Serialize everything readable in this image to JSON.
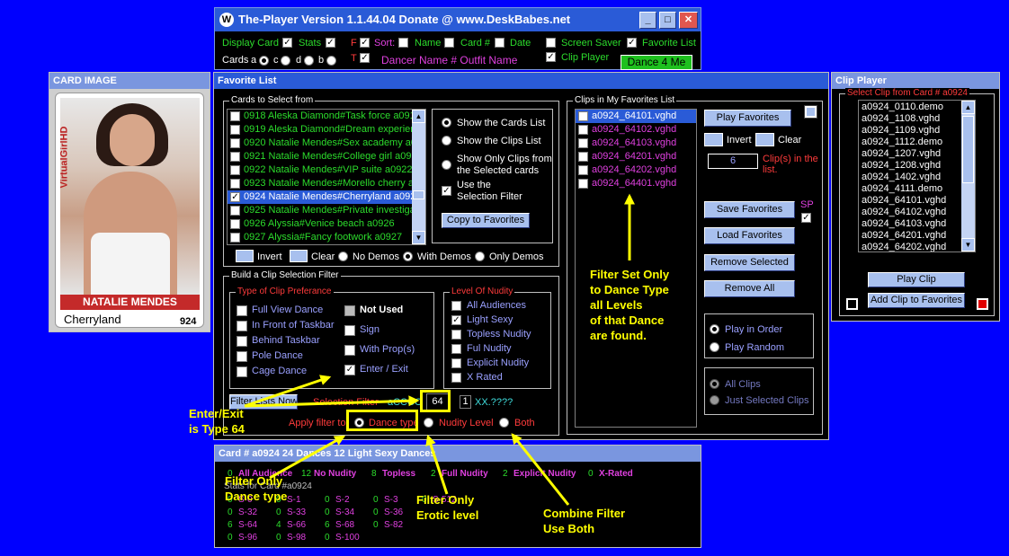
{
  "main_window": {
    "title": "The-Player  Version 1.1.44.04 Donate @ www.DeskBabes.net",
    "display_card": "Display Card",
    "stats": "Stats",
    "sort": "Sort:",
    "name": "Name",
    "card_num": "Card #",
    "date": "Date",
    "screen_saver": "Screen Saver",
    "favorite_list": "Favorite List",
    "cards": "Cards",
    "card_a": "a",
    "card_c": "c",
    "card_d": "d",
    "card_b": "b",
    "f": "F",
    "t": "T",
    "dancer_line": "Dancer Name # Outfit Name",
    "clip_player": "Clip Player",
    "dance_btn": "Dance 4 Me"
  },
  "card_image": {
    "title": "CARD IMAGE",
    "brand": "VirtualGirlHD",
    "name_banner": "NATALIE MENDES",
    "outfit": "Cherryland",
    "number": "924"
  },
  "favorite": {
    "title": "Favorite List",
    "cards_group": "Cards to Select from",
    "cards": [
      {
        "label": "0918 Aleska Diamond#Task force a0918",
        "checked": false,
        "selected": false
      },
      {
        "label": "0919 Aleska Diamond#Dream experience",
        "checked": false,
        "selected": false
      },
      {
        "label": "0920 Natalie Mendes#Sex academy a0920",
        "checked": false,
        "selected": false
      },
      {
        "label": "0921 Natalie Mendes#College girl a0921",
        "checked": false,
        "selected": false
      },
      {
        "label": "0922 Natalie Mendes#VIP suite a0922",
        "checked": false,
        "selected": false
      },
      {
        "label": "0923 Natalie Mendes#Morello cherry a0923",
        "checked": false,
        "selected": false
      },
      {
        "label": "0924 Natalie Mendes#Cherryland a0924",
        "checked": true,
        "selected": true
      },
      {
        "label": "0925 Natalie Mendes#Private investigator",
        "checked": false,
        "selected": false
      },
      {
        "label": "0926 Alyssia#Venice beach a0926",
        "checked": false,
        "selected": false
      },
      {
        "label": "0927 Alyssia#Fancy footwork a0927",
        "checked": false,
        "selected": false
      }
    ],
    "show_cards": "Show the Cards List",
    "show_clips": "Show the Clips List",
    "show_only1": "Show Only Clips from",
    "show_only2": "the Selected cards",
    "use_filter1": "Use the",
    "use_filter2": "Selection Filter",
    "copy_btn": "Copy to Favorites",
    "invert": "Invert",
    "clear": "Clear",
    "no_demos": "No Demos",
    "with_demos": "With Demos",
    "only_demos": "Only Demos",
    "build_group": "Build a Clip Selection Filter",
    "type_group": "Type of Clip Preferance",
    "types_left": [
      "Full View Dance",
      "In Front of Taskbar",
      "Behind Taskbar",
      "Pole Dance",
      "Cage Dance"
    ],
    "types_right": [
      "Not Used",
      "Sign",
      "With Prop(s)",
      "Enter / Exit"
    ],
    "nudity_group": "Level Of Nudity",
    "nudity": [
      {
        "label": "All Audiences",
        "checked": false
      },
      {
        "label": "Light Sexy",
        "checked": true
      },
      {
        "label": "Topless Nudity",
        "checked": false
      },
      {
        "label": "Ful Nudity",
        "checked": false
      },
      {
        "label": "Explicit Nudity",
        "checked": false
      },
      {
        "label": "X Rated",
        "checked": false
      }
    ],
    "filter_now": "Filter Lists Now",
    "sel_filter": "Selection Filter",
    "code": "aCCCC",
    "type_val": "64",
    "nudity_val": "1",
    "xx": "XX.????",
    "apply_to": "Apply filter to:",
    "apply_dance": "Dance type",
    "apply_nudity": "Nudity Level",
    "apply_both": "Both",
    "clips_group": "Clips in My Favorites List",
    "clips": [
      "a0924_64101.vghd",
      "a0924_64102.vghd",
      "a0924_64103.vghd",
      "a0924_64201.vghd",
      "a0924_64202.vghd",
      "a0924_64401.vghd"
    ],
    "play_fav": "Play Favorites",
    "invert2": "Invert",
    "clear2": "Clear",
    "count": "6",
    "count_label1": "Clip(s) in the",
    "count_label2": "list.",
    "save_fav": "Save Favorites",
    "sp": "SP",
    "load_fav": "Load Favorites",
    "remove_sel": "Remove Selected",
    "remove_all": "Remove All",
    "play_order": "Play in Order",
    "play_random": "Play Random",
    "all_clips": "All Clips",
    "just_sel": "Just Selected Clips"
  },
  "clip_player": {
    "title": "Clip Player",
    "group": "Select Clip from Card # a0924",
    "clips": [
      "a0924_0110.demo",
      "a0924_1108.vghd",
      "a0924_1109.vghd",
      "a0924_1112.demo",
      "a0924_1207.vghd",
      "a0924_1208.vghd",
      "a0924_1402.vghd",
      "a0924_4111.demo",
      "a0924_64101.vghd",
      "a0924_64102.vghd",
      "a0924_64103.vghd",
      "a0924_64201.vghd",
      "a0924_64202.vghd"
    ],
    "play_clip": "Play Clip",
    "add_fav": "Add Clip to Favorites"
  },
  "stats": {
    "title": "Card # a0924 24 Dances 12 Light Sexy Dances",
    "row1": [
      {
        "n": "0",
        "l": "All Audience"
      },
      {
        "n": "12",
        "l": "No Nudity"
      },
      {
        "n": "8",
        "l": "Topless"
      },
      {
        "n": "2",
        "l": "Full Nudity"
      },
      {
        "n": "2",
        "l": "Explicit Nudity"
      },
      {
        "n": "0",
        "l": "X-Rated"
      }
    ],
    "stats_for": "Stats for Card #a0924",
    "grid": [
      [
        {
          "n": "0",
          "l": "S-0"
        },
        {
          "n": "0",
          "l": "S-1"
        },
        {
          "n": "0",
          "l": "S-2"
        },
        {
          "n": "0",
          "l": "S-3"
        },
        {
          "n": "0",
          "l": "S-512"
        }
      ],
      [
        {
          "n": "0",
          "l": "S-32"
        },
        {
          "n": "0",
          "l": "S-33"
        },
        {
          "n": "0",
          "l": "S-34"
        },
        {
          "n": "0",
          "l": "S-36"
        }
      ],
      [
        {
          "n": "6",
          "l": "S-64"
        },
        {
          "n": "4",
          "l": "S-66"
        },
        {
          "n": "6",
          "l": "S-68"
        },
        {
          "n": "0",
          "l": "S-82"
        }
      ],
      [
        {
          "n": "0",
          "l": "S-96"
        },
        {
          "n": "0",
          "l": "S-98"
        },
        {
          "n": "0",
          "l": "S-100"
        }
      ]
    ]
  },
  "annotations": {
    "filter_set": [
      "Filter Set Only",
      "to Dance Type",
      "all Levels",
      "of that Dance",
      "are found."
    ],
    "enter_exit": [
      "Enter/Exit",
      "is Type 64"
    ],
    "filter_dance": [
      "Filter Only",
      "Dance type"
    ],
    "filter_erotic": [
      "Filter Only",
      "Erotic level"
    ],
    "combine": [
      "Combine Filter",
      "Use Both"
    ]
  },
  "colors": {
    "desktop": "#0000fe",
    "annotation": "#ffff00",
    "title_bar": "#2a5bd7"
  }
}
